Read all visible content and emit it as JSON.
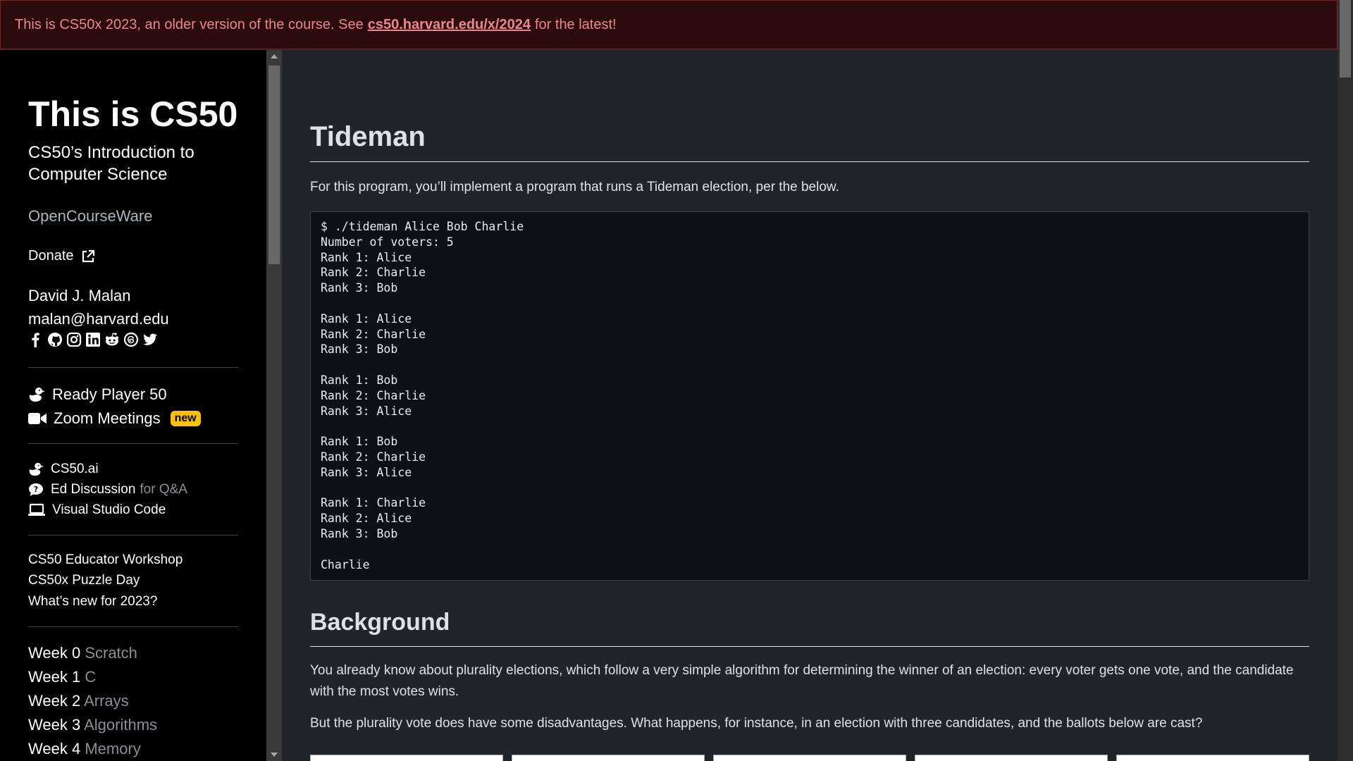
{
  "banner": {
    "text_before": "This is CS50x 2023, an older version of the course. See",
    "link_text": "cs50.harvard.edu/x/2024",
    "text_after": "for the latest!"
  },
  "sidebar": {
    "title": "This is CS50",
    "subtitle": "CS50’s Introduction to Computer Science",
    "opencourseware": "OpenCourseWare",
    "donate": "Donate",
    "author_name": "David J. Malan",
    "author_email": "malan@harvard.edu",
    "social_icons": [
      "facebook-icon",
      "github-icon",
      "instagram-icon",
      "linkedin-icon",
      "reddit-icon",
      "threads-icon",
      "twitter-icon"
    ],
    "group1": [
      {
        "label": "Ready Player 50",
        "icon": "duck-icon"
      },
      {
        "label": "Zoom Meetings",
        "icon": "video-camera-icon",
        "badge": "new"
      }
    ],
    "group2": [
      {
        "label": "CS50.ai",
        "icon": "duck-icon"
      },
      {
        "label": "Ed Discussion",
        "suffix": "for Q&A",
        "icon": "chat-bubble-icon"
      },
      {
        "label": "Visual Studio Code",
        "icon": "laptop-icon"
      }
    ],
    "group3": [
      "CS50 Educator Workshop",
      "CS50x Puzzle Day",
      "What’s new for 2023?"
    ],
    "weeks": [
      {
        "week": "Week 0",
        "topic": "Scratch"
      },
      {
        "week": "Week 1",
        "topic": "C"
      },
      {
        "week": "Week 2",
        "topic": "Arrays"
      },
      {
        "week": "Week 3",
        "topic": "Algorithms"
      },
      {
        "week": "Week 4",
        "topic": "Memory"
      }
    ]
  },
  "main": {
    "heading": "Tideman",
    "intro": "For this program, you’ll implement a program that runs a Tideman election, per the below.",
    "code": "$ ./tideman Alice Bob Charlie\nNumber of voters: 5\nRank 1: Alice\nRank 2: Charlie\nRank 3: Bob\n\nRank 1: Alice\nRank 2: Charlie\nRank 3: Bob\n\nRank 1: Bob\nRank 2: Charlie\nRank 3: Alice\n\nRank 1: Bob\nRank 2: Charlie\nRank 3: Alice\n\nRank 1: Charlie\nRank 2: Alice\nRank 3: Bob\n\nCharlie",
    "background_heading": "Background",
    "background_p1": "You already know about plurality elections, which follow a very simple algorithm for determining the winner of an election: every voter gets one vote, and the candidate with the most votes wins.",
    "background_p2": "But the plurality vote does have some disadvantages. What happens, for instance, in an election with three candidates, and the ballots below are cast?"
  },
  "colors": {
    "banner_bg": "#2c0b0e",
    "banner_text": "#ea868f",
    "sidebar_bg": "#000000",
    "main_bg": "#212529",
    "badge": "#ffc107"
  }
}
